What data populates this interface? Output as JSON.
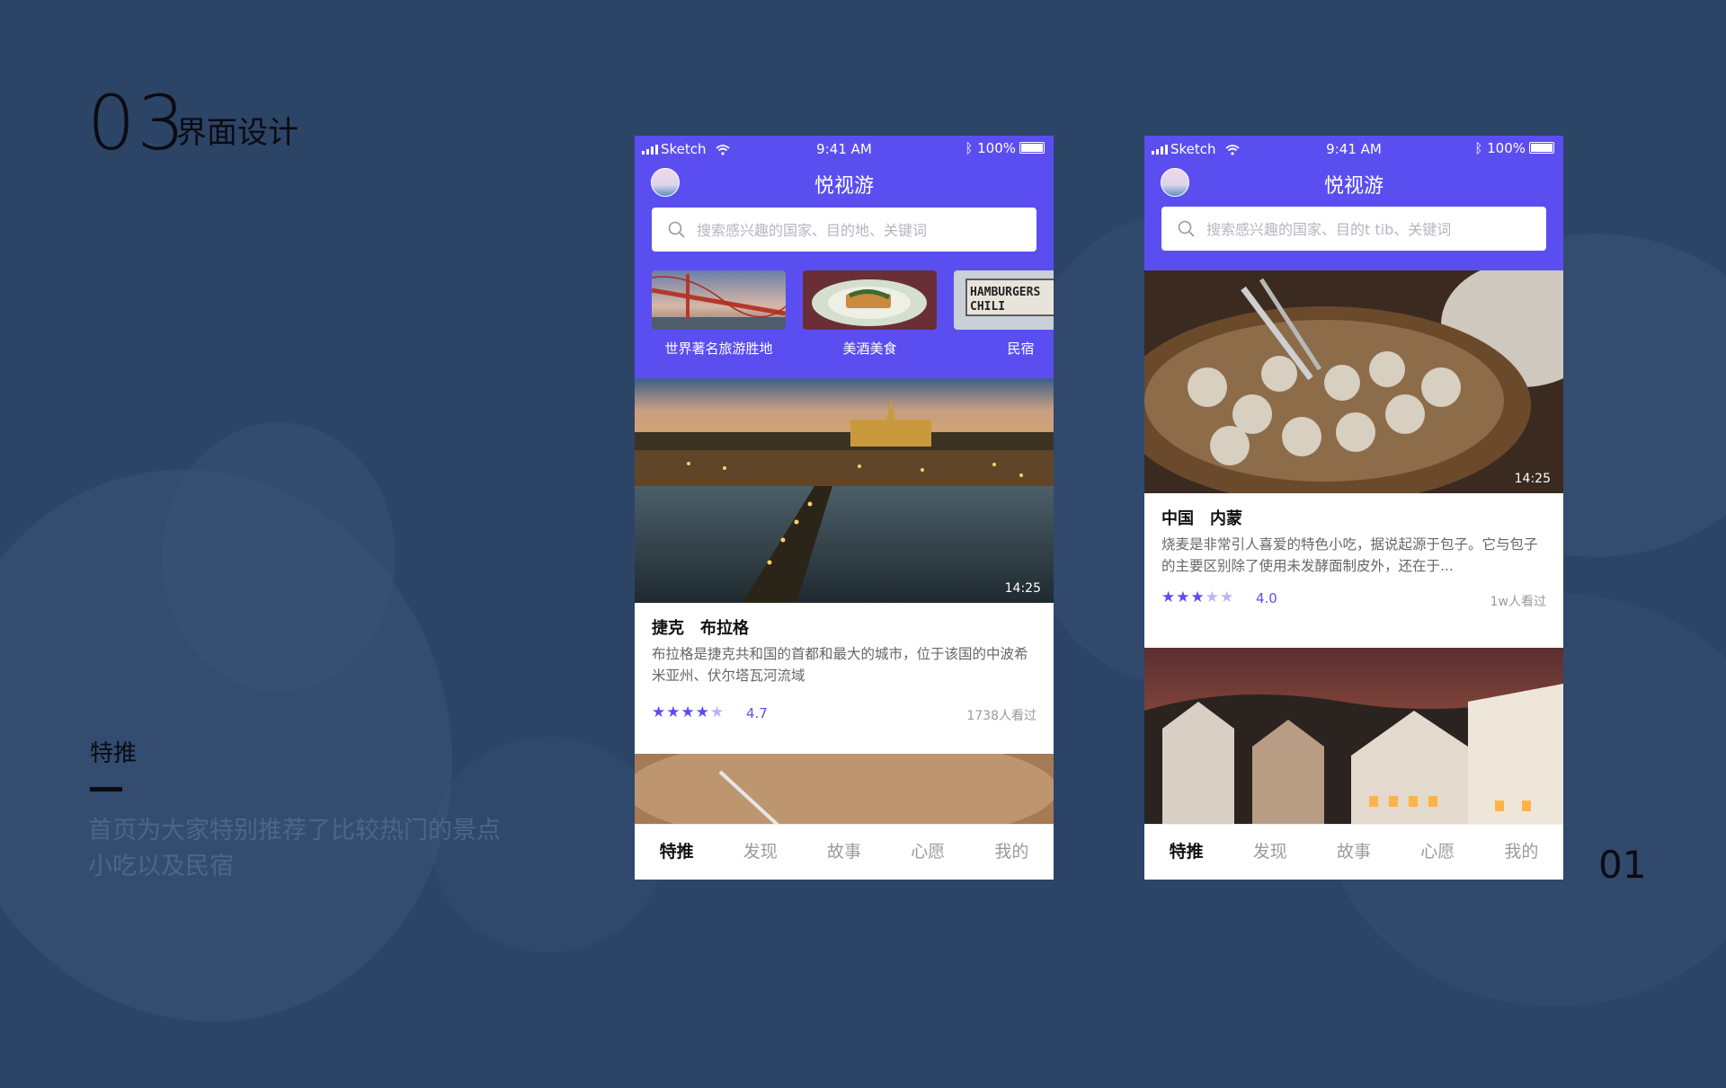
{
  "slide": {
    "number": "03",
    "title": "界面设计",
    "section_title": "特推",
    "description_lines": [
      "首页为大家特别推荐了比较热门的景点",
      "小吃以及民宿"
    ],
    "page_number": "01"
  },
  "colors": {
    "background": "#2c4466",
    "accent": "#5b4ef0",
    "text_dark": "#0b0b12"
  },
  "phone1": {
    "status": {
      "carrier": "Sketch",
      "time": "9:41 AM",
      "battery": "100%"
    },
    "app_title": "悦视游",
    "search_placeholder": "搜索感兴趣的国家、目的地、关键词",
    "categories": [
      {
        "label": "世界著名旅游胜地",
        "icon": "bridge-photo"
      },
      {
        "label": "美酒美食",
        "icon": "food-photo"
      },
      {
        "label": "民宿",
        "icon": "sign-photo",
        "sign_text": "HAMBURGER CHILI"
      }
    ],
    "feature": {
      "duration": "14:25",
      "country": "捷克",
      "city": "布拉格",
      "description": "布拉格是捷克共和国的首都和最大的城市，位于该国的中波希米亚州、伏尔塔瓦河流域",
      "rating": "4.7",
      "rating_value": 4.7,
      "stars_filled": 4,
      "views": "1738人看过"
    },
    "tabs": [
      "特推",
      "发现",
      "故事",
      "心愿",
      "我的"
    ],
    "active_tab": 0
  },
  "phone2": {
    "status": {
      "carrier": "Sketch",
      "time": "9:41 AM",
      "battery": "100%"
    },
    "app_title": "悦视游",
    "search_placeholder": "搜索感兴趣的国家、目的t tib、关键词",
    "feature": {
      "duration": "14:25",
      "country": "中国",
      "city": "内蒙",
      "description": "烧麦是非常引人喜爱的特色小吃，据说起源于包子。它与包子的主要区别除了使用未发酵面制皮外，还在于...",
      "rating": "4.0",
      "rating_value": 4.0,
      "stars_filled": 3,
      "views": "1w人看过"
    },
    "tabs": [
      "特推",
      "发现",
      "故事",
      "心愿",
      "我的"
    ],
    "active_tab": 0
  }
}
